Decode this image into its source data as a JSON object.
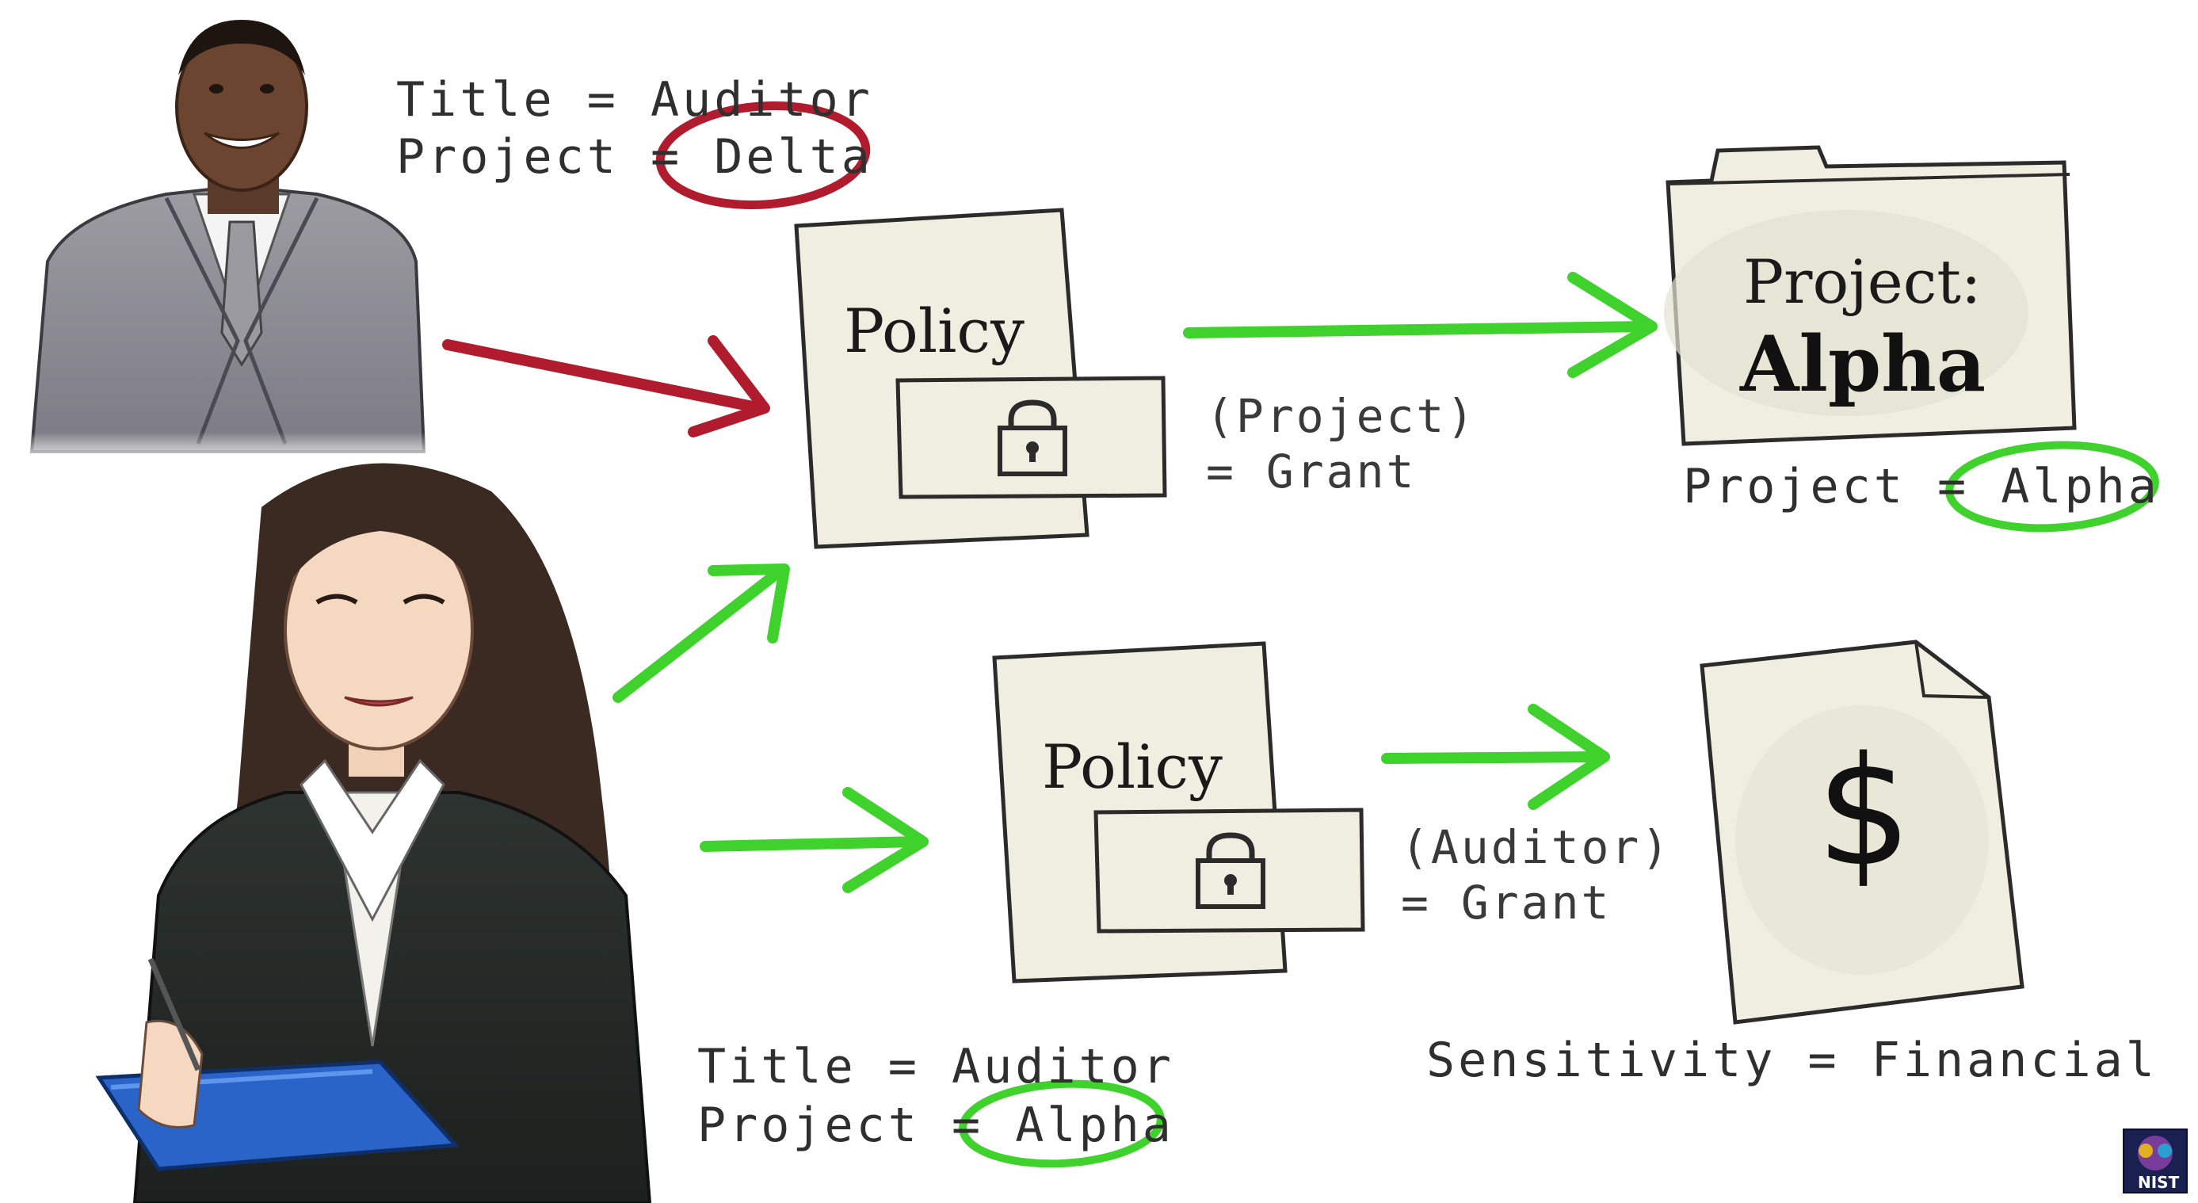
{
  "man_attributes": {
    "title_line": "Title = Auditor",
    "project_label": "Project =",
    "project_value": "Delta"
  },
  "woman_attributes": {
    "title_line": "Title = Auditor",
    "project_label": "Project =",
    "project_value": "Alpha"
  },
  "policy_top": {
    "title": "Policy",
    "condition_line1": "(Project)",
    "condition_line2": "= Grant"
  },
  "policy_bottom": {
    "title": "Policy",
    "condition_line1": "(Auditor)",
    "condition_line2": "= Grant"
  },
  "resource_folder": {
    "label_line1": "Project:",
    "label_line2": "Alpha",
    "attr_label": "Project =",
    "attr_value": "Alpha"
  },
  "resource_document": {
    "symbol": "$",
    "attr_line": "Sensitivity = Financial"
  },
  "logo": {
    "text": "NIST"
  },
  "colors": {
    "deny_red": "#b01c2e",
    "grant_green": "#3fd12c",
    "paper": "#efeee0",
    "ink": "#2f2f2f"
  }
}
